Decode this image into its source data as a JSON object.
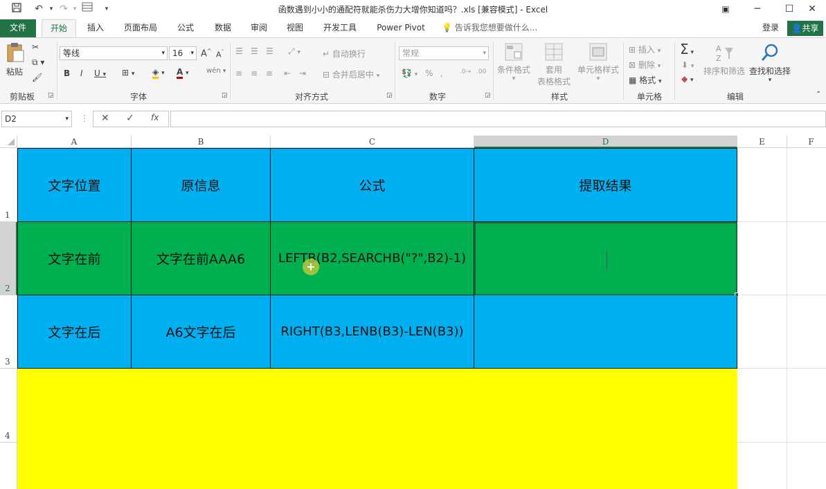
{
  "window": {
    "title": "函数遇到小小的通配符就能杀伤力大增你知道吗？.xls  [兼容模式] - Excel"
  },
  "tabs": [
    "文件",
    "开始",
    "插入",
    "页面布局",
    "公式",
    "数据",
    "审阅",
    "视图",
    "开发工具",
    "Power Pivot"
  ],
  "tell_me": "告诉我您想要做什么...",
  "login": "登录",
  "share": "共享",
  "ribbon": {
    "clipboard": {
      "paste": "粘贴",
      "label": "剪贴板"
    },
    "font": {
      "name": "等线",
      "size": "16",
      "label": "字体"
    },
    "alignment": {
      "wrap": "自动换行",
      "merge": "合并后居中",
      "label": "对齐方式"
    },
    "number": {
      "format": "常规",
      "percent": "%",
      "label": "数字"
    },
    "styles": {
      "conditional": "条件格式",
      "table_line1": "套用",
      "table_line2": "表格格式",
      "cell_styles": "单元格样式",
      "label": "样式"
    },
    "cells": {
      "insert": "插入",
      "delete": "删除",
      "format": "格式",
      "label": "单元格"
    },
    "editing": {
      "sort": "排序和筛选",
      "find": "查找和选择",
      "label": "编辑"
    }
  },
  "formula_bar": {
    "name_box": "D2",
    "content": ""
  },
  "columns": [
    "A",
    "B",
    "C",
    "D",
    "E",
    "F"
  ],
  "rows": [
    "1",
    "2",
    "3",
    "4"
  ],
  "cells": {
    "A1": "文字位置",
    "B1": "原信息",
    "C1": "公式",
    "D1": "提取结果",
    "A2": "文字在前",
    "B2": "文字在前AAA6",
    "C2": "LEFTB(B2,SEARCHB(\"?\",B2)-1)",
    "D2": "",
    "A3": "文字在后",
    "B3": "A6文字在后",
    "C3": "RIGHT(B3,LENB(B3)-LEN(B3))",
    "D3": ""
  },
  "colors": {
    "excel_green": "#217346",
    "header_fill": "#00b0f0",
    "row2_fill": "#00b050",
    "row4_fill": "#ffff00"
  }
}
